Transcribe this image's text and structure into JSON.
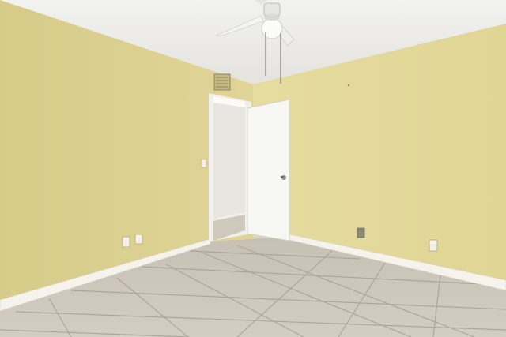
{
  "scene": {
    "kind": "empty-bedroom-photo",
    "features": [
      "textured-ceiling",
      "ceiling-fan",
      "hvac-vent",
      "open-door",
      "hallway",
      "baseboard",
      "tile-floor",
      "electrical-outlets",
      "light-switch"
    ]
  },
  "colors": {
    "wall_left": "#dcd08f",
    "wall_right": "#e5da9c",
    "ceiling": "#eeeeea",
    "floor": "#c9c3b8",
    "grout": "#a8a296",
    "baseboard": "#f4f2ea",
    "door": "#f6f6f3",
    "hallway_wall": "#e9e8e2",
    "fan_body": "#f1f1ef"
  }
}
